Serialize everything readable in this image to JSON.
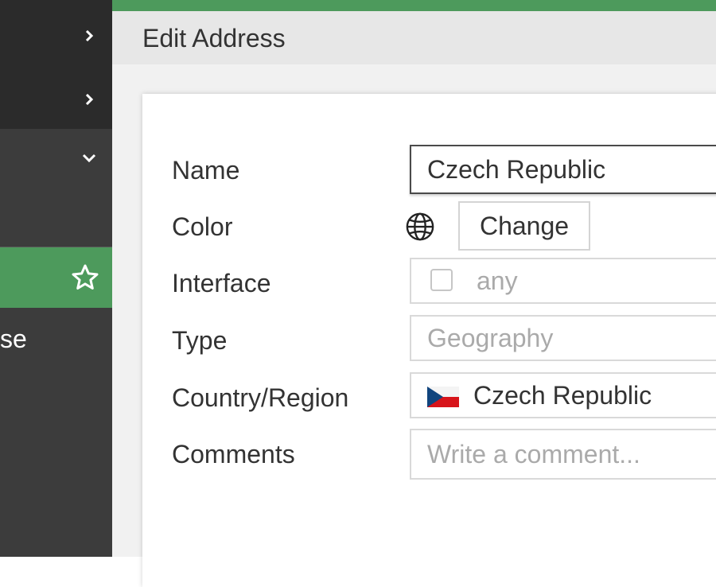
{
  "sidebar": {
    "partial_label": "se",
    "icons": [
      "chevron-right-icon",
      "chevron-right-icon",
      "chevron-down-icon",
      "star-icon"
    ]
  },
  "header": {
    "title": "Edit Address",
    "accent_color": "#4d9a5c"
  },
  "form": {
    "name": {
      "label": "Name",
      "value": "Czech Republic"
    },
    "color": {
      "label": "Color",
      "icon": "globe-icon",
      "button_label": "Change"
    },
    "interface": {
      "label": "Interface",
      "value": "any",
      "checked": false
    },
    "type": {
      "label": "Type",
      "value": "Geography"
    },
    "country": {
      "label": "Country/Region",
      "value": "Czech Republic",
      "flag_icon": "czech-flag-icon"
    },
    "comments": {
      "label": "Comments",
      "placeholder": "Write a comment..."
    }
  }
}
